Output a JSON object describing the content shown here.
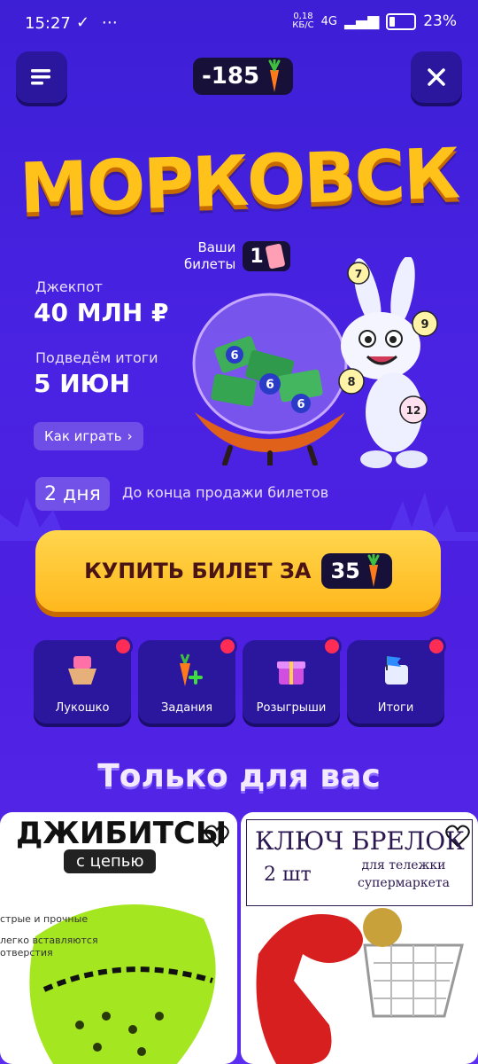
{
  "status": {
    "time": "15:27",
    "speed_top": "0,18",
    "speed_bottom": "КБ/С",
    "network": "4G",
    "battery": "23%"
  },
  "header": {
    "balance": "-185"
  },
  "hero": {
    "title": "Морковск",
    "tickets_label_1": "Ваши",
    "tickets_label_2": "билеты",
    "tickets_count": "1",
    "jackpot_label": "Джекпот",
    "jackpot_value": "40 МЛН ₽",
    "results_label": "Подведём итоги",
    "results_value": "5 ИЮН",
    "how_to_play": "Как играть",
    "days_left": "2 дня",
    "days_text": "До конца продажи билетов",
    "ball_numbers": [
      "7",
      "9",
      "8",
      "12",
      "6",
      "6",
      "6"
    ]
  },
  "buy": {
    "label": "КУПИТЬ БИЛЕТ ЗА",
    "price": "35"
  },
  "tiles": [
    {
      "label": "Лукошко"
    },
    {
      "label": "Задания"
    },
    {
      "label": "Розыгрыши"
    },
    {
      "label": "Итоги"
    }
  ],
  "section": {
    "title": "Только для вас"
  },
  "cards": {
    "left": {
      "title": "ДЖИБИТСЫ",
      "subtitle": "с цепью",
      "text1": "стрые и прочные",
      "text2a": "легко вставляются",
      "text2b": "отверстия"
    },
    "right": {
      "title": "КЛЮЧ БРЕЛОК",
      "subtitle": "2 шт",
      "note1": "для тележки",
      "note2": "супермаркета"
    }
  },
  "colors": {
    "background": "#4a22e3",
    "accent": "#ffc21a",
    "dark": "#17113a",
    "notify": "#ff2d55"
  }
}
